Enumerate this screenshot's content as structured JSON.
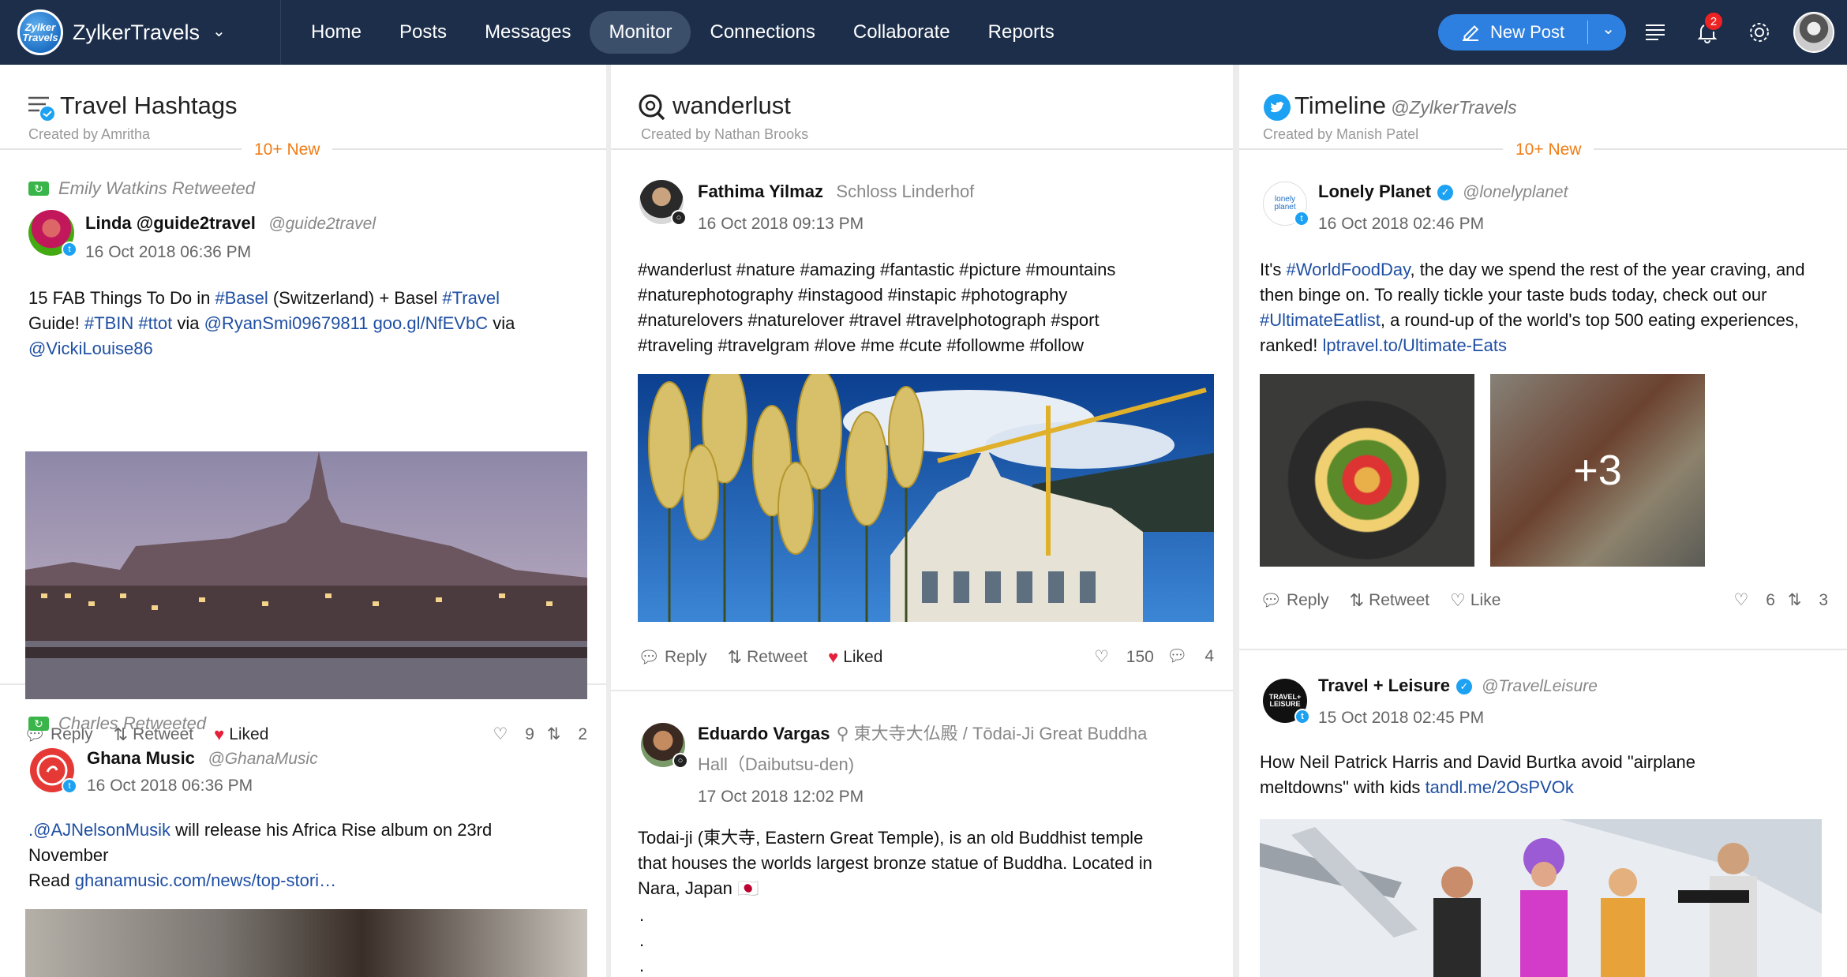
{
  "brand": {
    "name": "ZylkerTravels",
    "logo_text": "Zylker Travels"
  },
  "nav": {
    "items": [
      {
        "label": "Home"
      },
      {
        "label": "Posts"
      },
      {
        "label": "Messages"
      },
      {
        "label": "Monitor",
        "active": true
      },
      {
        "label": "Connections"
      },
      {
        "label": "Collaborate"
      },
      {
        "label": "Reports"
      }
    ],
    "new_post_label": "New Post",
    "notification_count": "2"
  },
  "columns": [
    {
      "title": "Travel Hashtags",
      "subtitle": "Created by Amritha",
      "new_badge": "10+ New",
      "posts": [
        {
          "retweeted_by": "Emily Watkins Retweeted",
          "name": "Linda @guide2travel",
          "handle": "@guide2travel",
          "time": "16 Oct 2018 06:36 PM",
          "body_parts": [
            "15 FAB Things To Do in ",
            "#Basel",
            " (Switzerland) + Basel ",
            "#Travel",
            " Guide! ",
            "#TBIN",
            " ",
            "#ttot",
            " via ",
            "@RyanSmi09679811",
            " ",
            "goo.gl/NfEVbC",
            " via ",
            "@VickiLouise86"
          ],
          "actions": {
            "reply": "Reply",
            "retweet": "Retweet",
            "like": "Liked"
          },
          "counts": {
            "likes": "9",
            "retweets": "2"
          }
        },
        {
          "retweeted_by": "Charles Retweeted",
          "name": "Ghana Music",
          "handle": "@GhanaMusic",
          "time": "16 Oct 2018 06:36 PM",
          "body_parts": [
            ".@AJNelsonMusik",
            " will release his Africa Rise album on 23rd November",
            "Read ",
            "ghanamusic.com/news/top-stori…"
          ]
        }
      ]
    },
    {
      "title": "wanderlust",
      "subtitle": "Created by Nathan Brooks",
      "posts": [
        {
          "name": "Fathima Yilmaz",
          "location": "Schloss Linderhof",
          "time": "16 Oct 2018 09:13 PM",
          "hashtags": "#wanderlust #nature #amazing #fantastic #picture #mountains #naturephotography #instagood #instapic #photography #naturelovers #naturelover #travel #travelphotograph #sport #traveling #travelgram #love #me #cute #followme #follow",
          "actions": {
            "reply": "Reply",
            "retweet": "Retweet",
            "like": "Liked"
          },
          "counts": {
            "likes": "150",
            "comments": "4"
          }
        },
        {
          "name": "Eduardo Vargas",
          "location": "東大寺大仏殿 / Tōdai-Ji Great Buddha Hall（Daibutsu-den)",
          "time": "17 Oct 2018 12:02 PM",
          "body": "Todai-ji (東大寺, Eastern Great Temple), is an old Buddhist temple that houses the worlds largest bronze statue of Buddha. Located in Nara, Japan 🇯🇵",
          "dots": "."
        }
      ]
    },
    {
      "title": "Timeline",
      "handle": "@ZylkerTravels",
      "subtitle": "Created by Manish Patel",
      "new_badge": "10+ New",
      "posts": [
        {
          "name": "Lonely Planet",
          "handle": "@lonelyplanet",
          "avatar_text": "lonely planet",
          "time": "16 Oct 2018 02:46 PM",
          "body_parts": [
            "It's ",
            "#WorldFoodDay",
            ", the day we spend the rest of the year craving, and then binge on. To really tickle your taste buds today, check out our ",
            "#UltimateEatlist",
            ", a round-up of the world's top 500 eating experiences, ranked! ",
            "lptravel.to/Ultimate-Eats"
          ],
          "more_images": "+3",
          "actions": {
            "reply": "Reply",
            "retweet": "Retweet",
            "like": "Like"
          },
          "counts": {
            "likes": "6",
            "retweets": "3"
          }
        },
        {
          "name": "Travel + Leisure",
          "handle": "@TravelLeisure",
          "avatar_text": "TRAVEL+ LEISURE",
          "time": "15 Oct 2018 02:45 PM",
          "body_parts": [
            "How Neil Patrick Harris and David Burtka avoid \"airplane meltdowns\" with kids ",
            "tandl.me/2OsPVOk"
          ]
        }
      ]
    }
  ]
}
